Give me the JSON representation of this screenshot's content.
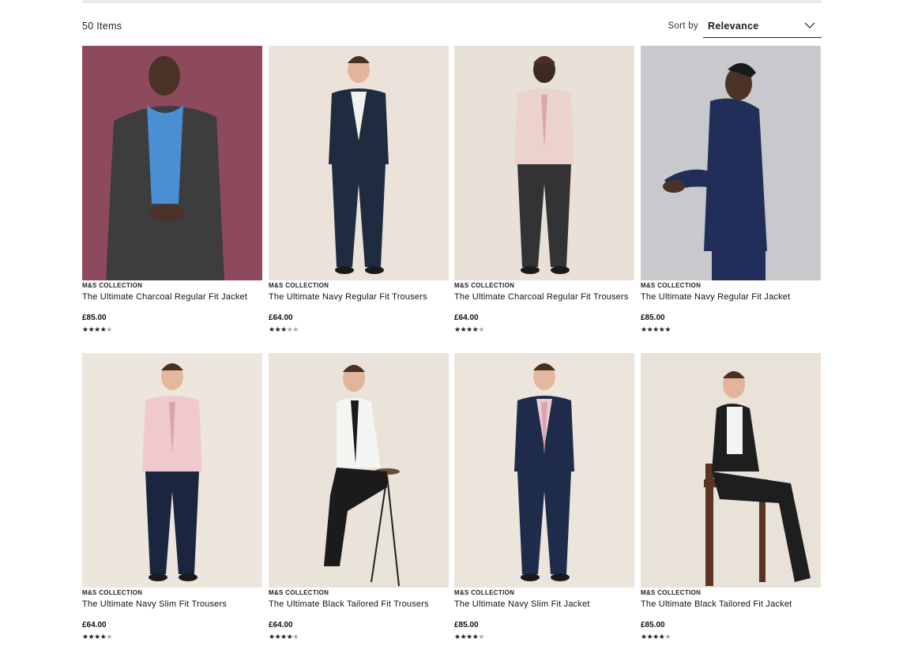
{
  "results": {
    "count_label": "50 Items"
  },
  "sort": {
    "label": "Sort by",
    "selected": "Relevance"
  },
  "products": [
    {
      "brand": "M&S COLLECTION",
      "name": "The Ultimate Charcoal Regular Fit Jacket",
      "price": "£85.00",
      "rating": 4,
      "bg": "#8e4a5d",
      "suit": "#3d3d3f",
      "shirt": "#4a8fd4",
      "trouser": "#3a3a3c",
      "skin": "#4a3326",
      "pose": "jacket"
    },
    {
      "brand": "M&S COLLECTION",
      "name": "The Ultimate Navy Regular Fit Trousers",
      "price": "£64.00",
      "rating": 3.5,
      "bg": "#ebe3da",
      "suit": "#1f2c40",
      "shirt": "#f3f1ee",
      "trouser": "#1f2c40",
      "skin": "#e2b59b",
      "pose": "standing"
    },
    {
      "brand": "M&S COLLECTION",
      "name": "The Ultimate Charcoal Regular Fit Trousers",
      "price": "£64.00",
      "rating": 4,
      "bg": "#e7e1d8",
      "suit": "#e9cfc8",
      "shirt": "#ecd2cc",
      "trouser": "#333335",
      "skin": "#3d2a20",
      "pose": "walking"
    },
    {
      "brand": "M&S COLLECTION",
      "name": "The Ultimate Navy Regular Fit Jacket",
      "price": "£85.00",
      "rating": 5,
      "bg": "#c7c9cc",
      "suit": "#222e5a",
      "shirt": "#222e5a",
      "trouser": "#222e5a",
      "skin": "#4a3326",
      "pose": "side"
    },
    {
      "brand": "M&S COLLECTION",
      "name": "The Ultimate Navy Slim Fit Trousers",
      "price": "£64.00",
      "rating": 4,
      "bg": "#ece6dd",
      "suit": "#f0c9cf",
      "shirt": "#f0c9cf",
      "trouser": "#1c2540",
      "skin": "#e4b89e",
      "pose": "shirt"
    },
    {
      "brand": "M&S COLLECTION",
      "name": "The Ultimate Black Tailored Fit Trousers",
      "price": "£64.00",
      "rating": 4,
      "bg": "#e9e3da",
      "suit": "#f5f5f3",
      "shirt": "#f5f5f3",
      "trouser": "#1b1b1c",
      "skin": "#e2b59b",
      "pose": "stool"
    },
    {
      "brand": "M&S COLLECTION",
      "name": "The Ultimate Navy Slim Fit Jacket",
      "price": "£85.00",
      "rating": 4,
      "bg": "#ebe5dc",
      "suit": "#1e2b4a",
      "shirt": "#eecbd0",
      "trouser": "#1e2b4a",
      "skin": "#e4b89e",
      "pose": "jacket-front"
    },
    {
      "brand": "M&S COLLECTION",
      "name": "The Ultimate Black Tailored Fit Jacket",
      "price": "£85.00",
      "rating": 4,
      "bg": "#e8e2d9",
      "suit": "#1e1e1f",
      "shirt": "#f3f3f1",
      "trouser": "#1e1e1f",
      "skin": "#e2b59b",
      "pose": "chair"
    }
  ]
}
